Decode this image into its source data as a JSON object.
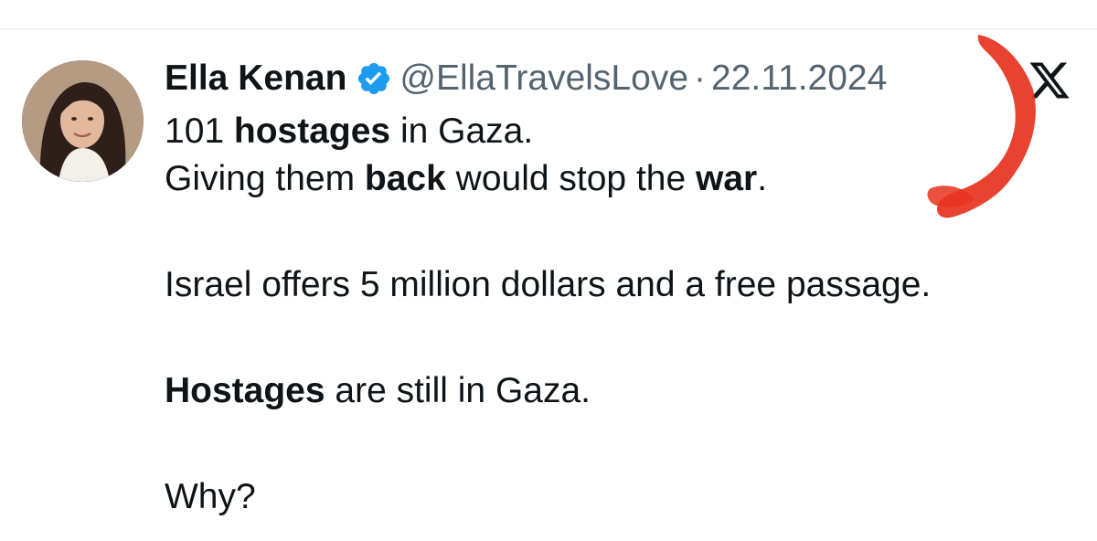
{
  "tweet": {
    "author_name": "Ella Kenan",
    "handle": "@EllaTravelsLove",
    "separator": "·",
    "date": "22.11.2024",
    "avatar_icon": "avatar",
    "verified_icon": "verified-badge-icon",
    "platform_icon": "x-logo-icon",
    "lines": {
      "l1_a": "101 ",
      "l1_b": "hostages",
      "l1_c": " in Gaza.",
      "l2_a": "Giving them ",
      "l2_b": "back",
      "l2_c": " would stop the ",
      "l2_d": "war",
      "l2_e": ".",
      "l3": "Israel offers 5 million dollars and a free passage.",
      "l4_a": "Hostages",
      "l4_b": " are still in Gaza.",
      "l5": "Why?"
    }
  },
  "colors": {
    "text_primary": "#0f1419",
    "text_secondary": "#536471",
    "verified_blue": "#1d9bf0",
    "annotation_red": "#e8321e"
  }
}
